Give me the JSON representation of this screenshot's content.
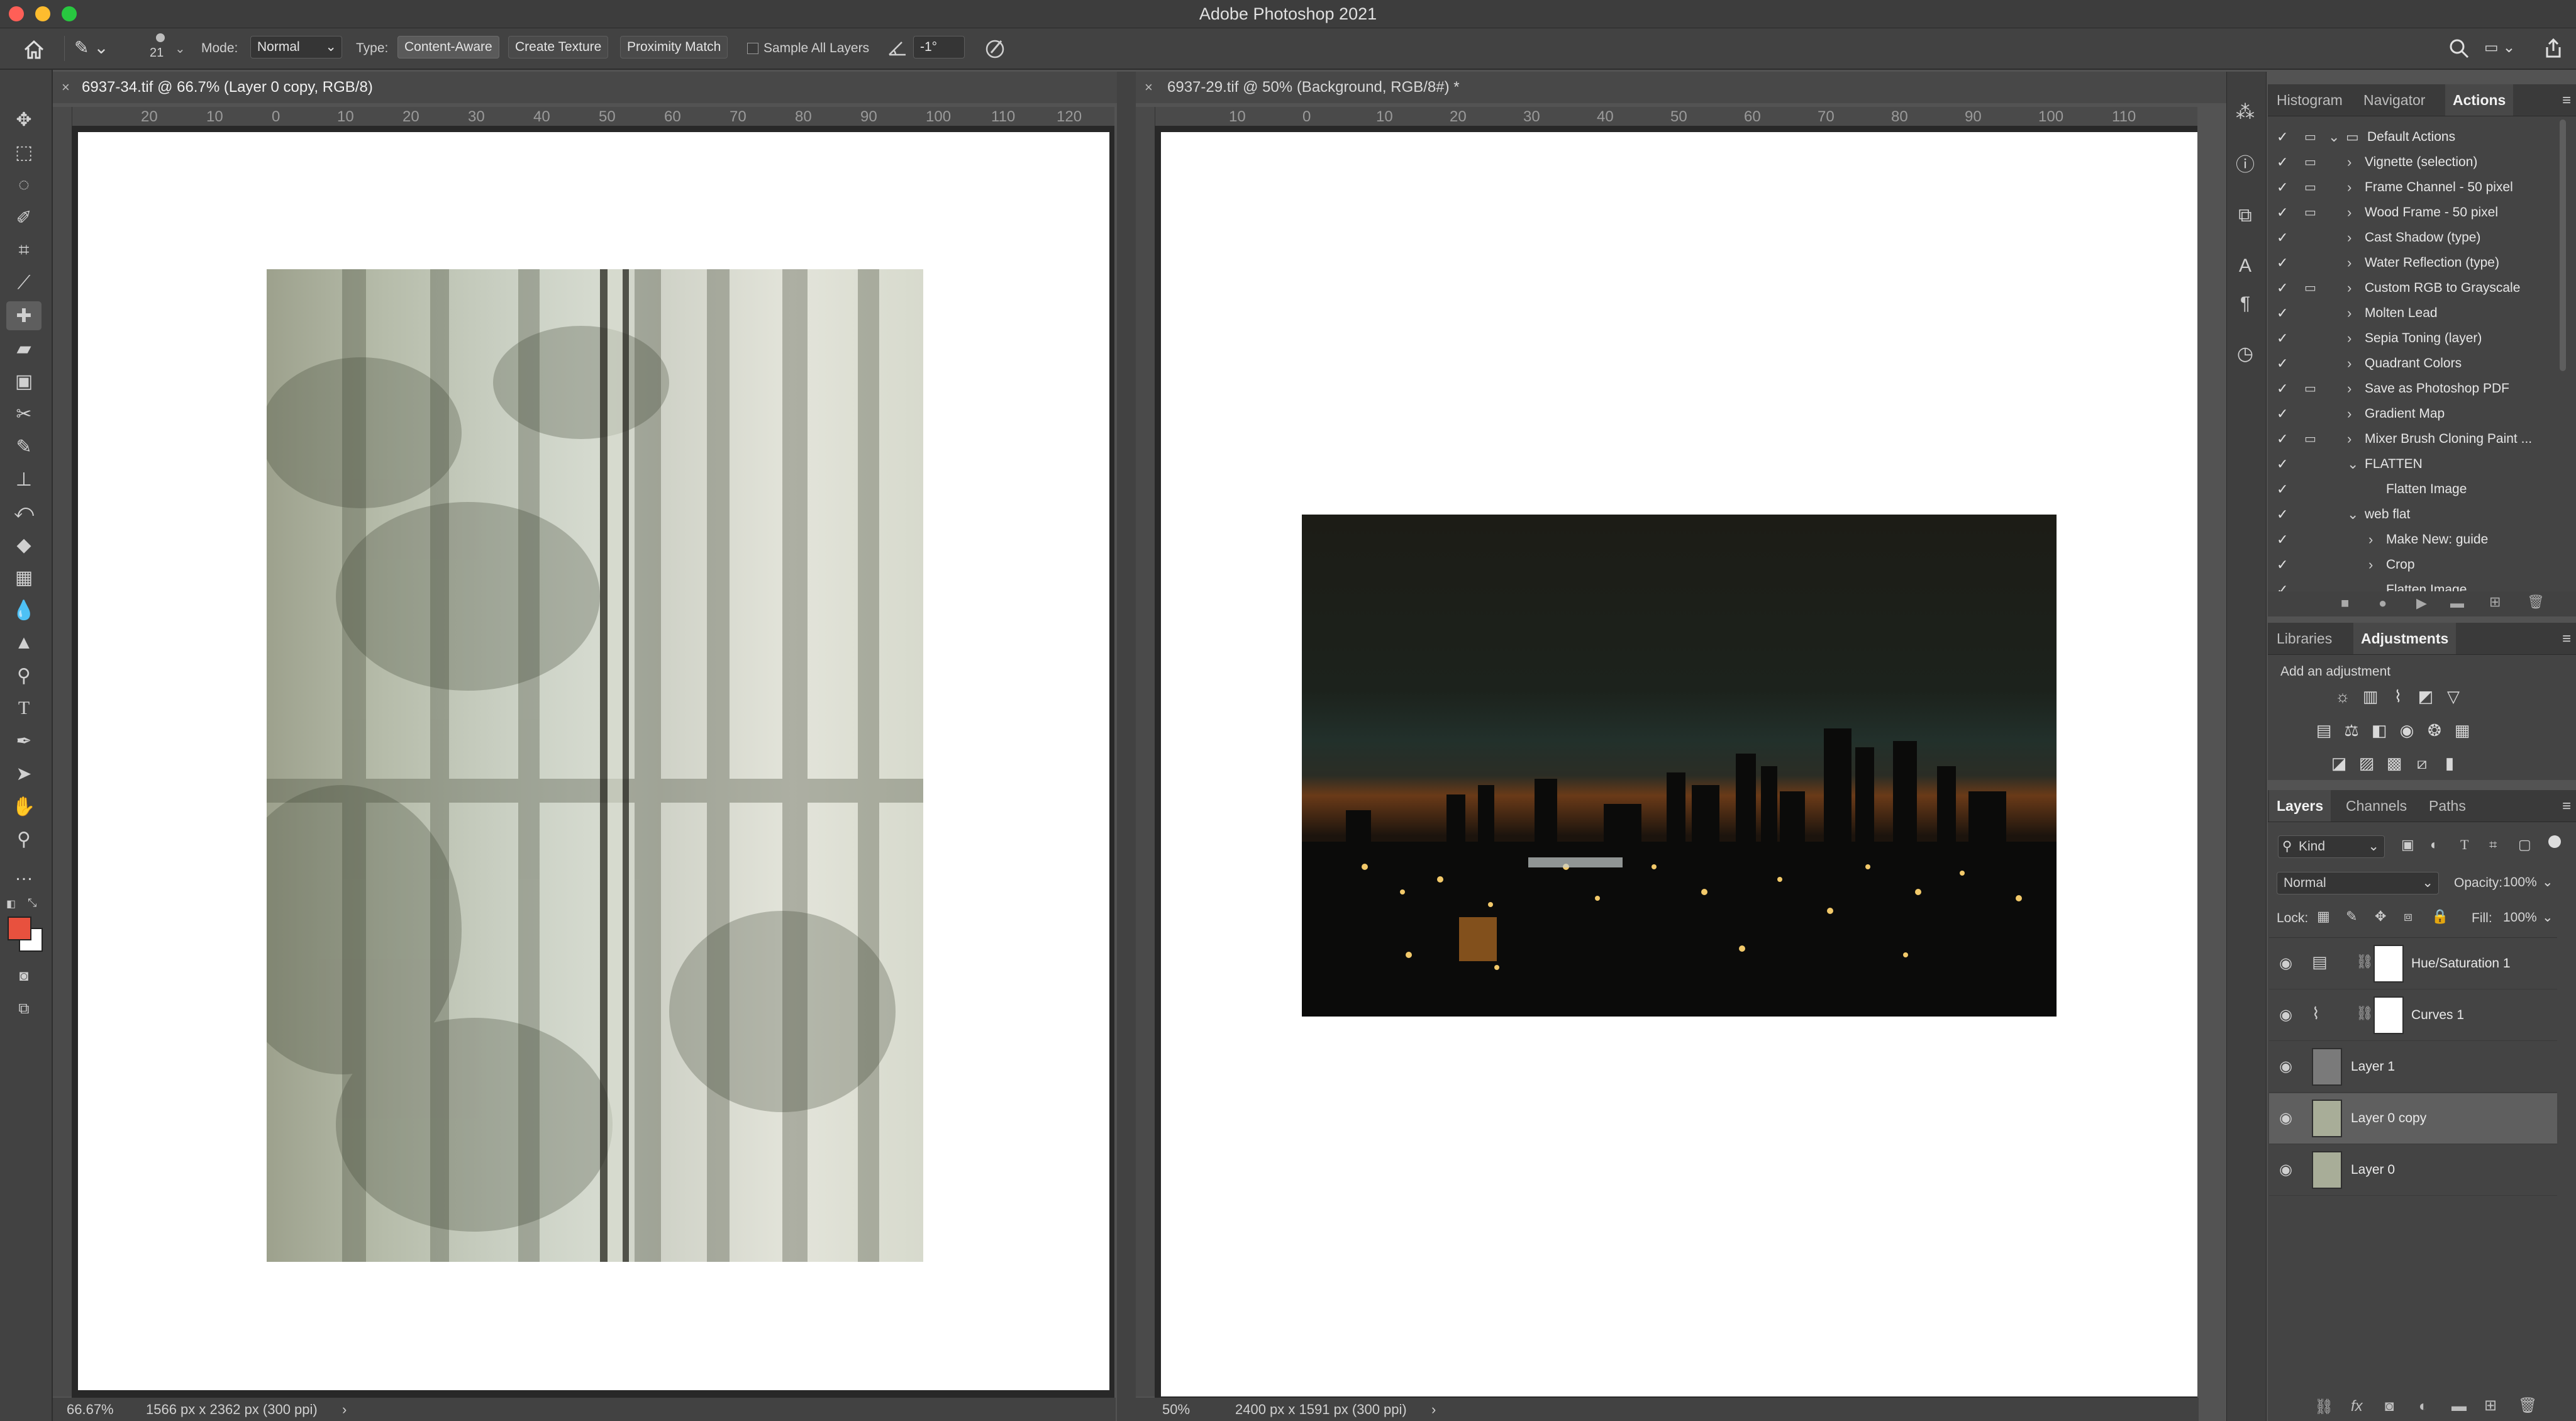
{
  "app": {
    "title": "Adobe Photoshop 2021"
  },
  "window_controls": {
    "close_color": "#ff5f57",
    "minimize_color": "#febc2e",
    "zoom_color": "#28c840"
  },
  "options_bar": {
    "brush_size": "21",
    "mode_label": "Mode:",
    "mode_value": "Normal",
    "type_label": "Type:",
    "type_buttons": [
      "Content-Aware",
      "Create Texture",
      "Proximity Match"
    ],
    "active_type": "Content-Aware",
    "sample_all_layers_label": "Sample All Layers",
    "sample_all_layers_checked": false,
    "angle_value": "-1°"
  },
  "tools": [
    "move-tool",
    "marquee-tool",
    "lasso-tool",
    "quick-selection-tool",
    "crop-tool",
    "eyedropper-tool",
    "spot-healing-brush-tool",
    "healing-brush-tool",
    "patch-tool",
    "content-aware-move-tool",
    "brush-tool",
    "clone-stamp-tool",
    "history-brush-tool",
    "eraser-tool",
    "gradient-tool",
    "blur-tool",
    "dodge-tool",
    "pen-tool",
    "type-tool",
    "path-selection-tool",
    "hand-tool",
    "zoom-tool",
    "edit-toolbar"
  ],
  "active_tool": "spot-healing-brush-tool",
  "foreground_color": "#e8513e",
  "background_color": "#ffffff",
  "documents": [
    {
      "tab_label": "6937-34.tif @ 66.7% (Layer 0 copy, RGB/8)",
      "active": true,
      "ruler_ticks": [
        "20",
        "10",
        "0",
        "10",
        "20",
        "30",
        "40",
        "50",
        "60",
        "70",
        "80",
        "90",
        "100",
        "110",
        "120"
      ],
      "zoom": "66.67%",
      "dimensions": "1566 px x 2362 px (300 ppi)"
    },
    {
      "tab_label": "6937-29.tif @ 50% (Background, RGB/8#) *",
      "active": false,
      "ruler_ticks": [
        "10",
        "0",
        "10",
        "20",
        "30",
        "40",
        "50",
        "60",
        "70",
        "80",
        "90",
        "100",
        "110"
      ],
      "zoom": "50%",
      "dimensions": "2400 px x 1591 px (300 ppi)"
    }
  ],
  "right_panels": {
    "top_tabs": [
      "Histogram",
      "Navigator",
      "Actions"
    ],
    "top_active": "Actions",
    "actions": [
      {
        "label": "Default Actions",
        "level": 0,
        "expanded": true,
        "folder": true,
        "dialog": true
      },
      {
        "label": "Vignette (selection)",
        "level": 1,
        "expanded": false,
        "dialog": true
      },
      {
        "label": "Frame Channel - 50 pixel",
        "level": 1,
        "expanded": false,
        "dialog": true
      },
      {
        "label": "Wood Frame - 50 pixel",
        "level": 1,
        "expanded": false,
        "dialog": true
      },
      {
        "label": "Cast Shadow (type)",
        "level": 1,
        "expanded": false,
        "dialog": false
      },
      {
        "label": "Water Reflection (type)",
        "level": 1,
        "expanded": false,
        "dialog": false
      },
      {
        "label": "Custom RGB to Grayscale",
        "level": 1,
        "expanded": false,
        "dialog": true
      },
      {
        "label": "Molten Lead",
        "level": 1,
        "expanded": false,
        "dialog": false
      },
      {
        "label": "Sepia Toning (layer)",
        "level": 1,
        "expanded": false,
        "dialog": false
      },
      {
        "label": "Quadrant Colors",
        "level": 1,
        "expanded": false,
        "dialog": false
      },
      {
        "label": "Save as Photoshop PDF",
        "level": 1,
        "expanded": false,
        "dialog": true
      },
      {
        "label": "Gradient Map",
        "level": 1,
        "expanded": false,
        "dialog": false
      },
      {
        "label": "Mixer Brush Cloning Paint ...",
        "level": 1,
        "expanded": false,
        "dialog": true
      },
      {
        "label": "FLATTEN",
        "level": 1,
        "expanded": true,
        "dialog": false
      },
      {
        "label": "Flatten Image",
        "level": 2,
        "expanded": null,
        "dialog": false
      },
      {
        "label": "web flat",
        "level": 1,
        "expanded": true,
        "dialog": false
      },
      {
        "label": "Make New: guide",
        "level": 2,
        "expanded": false,
        "dialog": false
      },
      {
        "label": "Crop",
        "level": 2,
        "expanded": false,
        "dialog": false
      },
      {
        "label": "Flatten Image",
        "level": 2,
        "expanded": null,
        "dialog": false
      }
    ],
    "mid_tabs": [
      "Libraries",
      "Adjustments"
    ],
    "mid_active": "Adjustments",
    "adjustments_hint": "Add an adjustment",
    "bottom_tabs": [
      "Layers",
      "Channels",
      "Paths"
    ],
    "bottom_active": "Layers",
    "layers_filter": "Kind",
    "blend_mode": "Normal",
    "opacity_label": "Opacity:",
    "opacity_value": "100%",
    "lock_label": "Lock:",
    "fill_label": "Fill:",
    "fill_value": "100%",
    "layers": [
      {
        "name": "Hue/Saturation 1",
        "type": "adjustment",
        "icon": "hue-saturation-icon",
        "selected": false
      },
      {
        "name": "Curves 1",
        "type": "adjustment",
        "icon": "curves-icon",
        "selected": false
      },
      {
        "name": "Layer 1",
        "type": "pixel",
        "thumb": "#7a7a7a",
        "selected": false
      },
      {
        "name": "Layer 0 copy",
        "type": "pixel",
        "thumb": "#a8ad98",
        "selected": true
      },
      {
        "name": "Layer 0",
        "type": "pixel",
        "thumb": "#a8ad98",
        "selected": false
      }
    ]
  }
}
